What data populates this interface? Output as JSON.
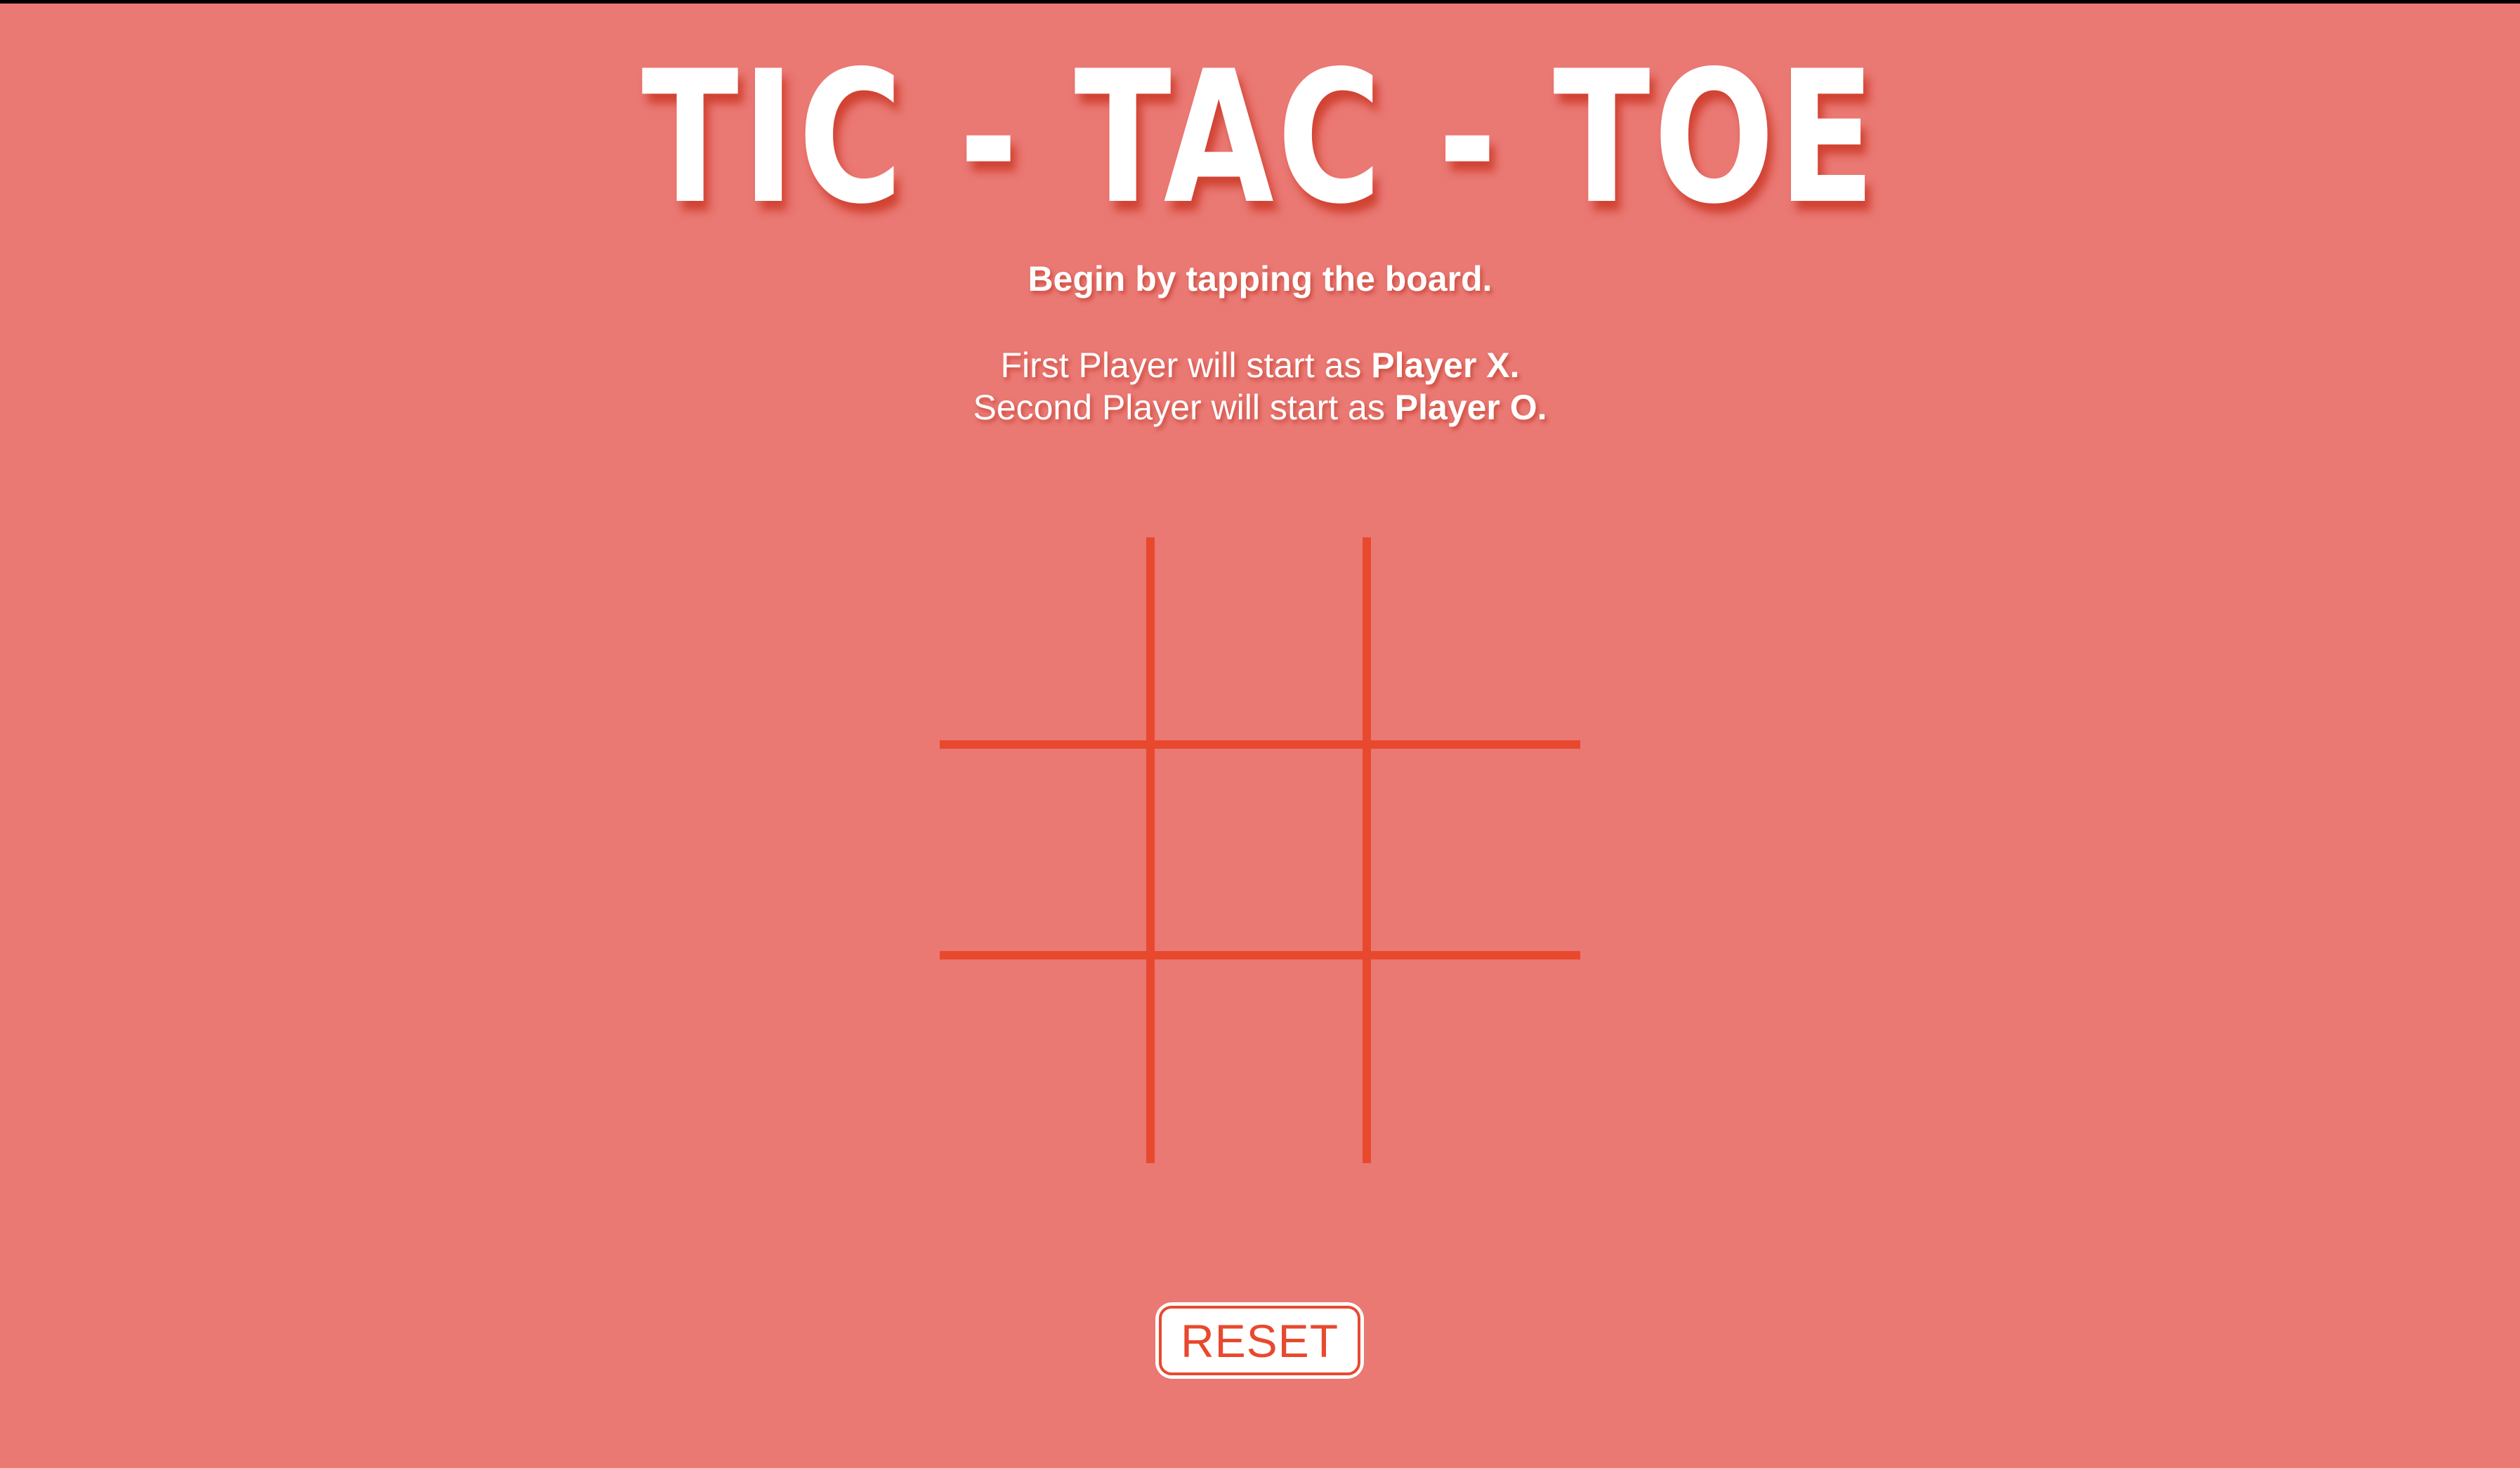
{
  "title": "TIC - TAC - TOE",
  "instruction": "Begin by tapping the board.",
  "players": {
    "first_prefix": "First Player will start as ",
    "first_name": "Player X.",
    "second_prefix": "Second Player will start as ",
    "second_name": "Player O."
  },
  "board": {
    "cells": [
      "",
      "",
      "",
      "",
      "",
      "",
      "",
      "",
      ""
    ]
  },
  "reset_label": "RESET",
  "colors": {
    "background": "#EA7873",
    "grid_line": "#E8492E",
    "title_text": "#FFFFFF",
    "button_text": "#E8492E"
  }
}
